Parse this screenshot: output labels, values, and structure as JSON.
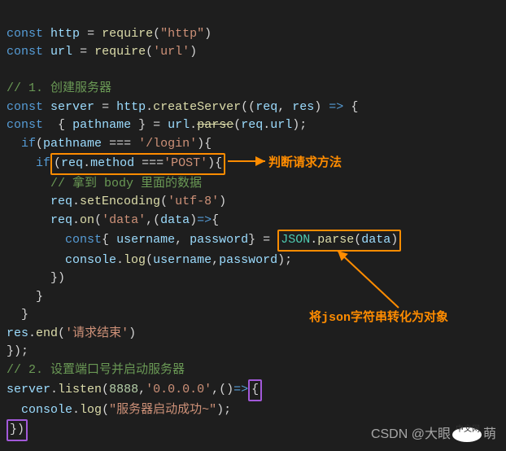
{
  "line1": {
    "kw": "const",
    "var": "http",
    "eq": "=",
    "fn": "require",
    "lp": "(",
    "str": "\"http\"",
    "rp": ")"
  },
  "line2": {
    "kw": "const",
    "var": "url",
    "eq": "=",
    "fn": "require",
    "lp": "(",
    "str": "'url'",
    "rp": ")"
  },
  "comment1": "// 1. 创建服务器",
  "line4": {
    "kw": "const",
    "var": "server",
    "eq": "=",
    "obj": "http",
    "dot": ".",
    "fn": "createServer",
    "lp": "(",
    "p1": "(",
    "a1": "req",
    "c": ",",
    "a2": "res",
    "p2": ")",
    "arrow": "=>",
    "lb": "{"
  },
  "line5": {
    "kw": "const",
    "lb": "{",
    "var": "pathname",
    "rb": "}",
    "eq": "=",
    "obj": "url",
    "dot": ".",
    "fn": "parse",
    "lp": "(",
    "a1": "req",
    "d2": ".",
    "a2": "url",
    "rp": ")",
    "sc": ";"
  },
  "line6": {
    "kw": "if",
    "lp": "(",
    "var": "pathname",
    "op": "===",
    "str": "'/login'",
    "rp": ")",
    "lb": "{"
  },
  "line7": {
    "kw": "if",
    "lp": "(",
    "a1": "req",
    "dot": ".",
    "a2": "method",
    "op": "===",
    "str": "'POST'",
    "rp": ")",
    "lb": "{"
  },
  "comment2": "// 拿到 body 里面的数据",
  "line9": {
    "a1": "req",
    "dot": ".",
    "fn": "setEncoding",
    "lp": "(",
    "str": "'utf-8'",
    "rp": ")"
  },
  "line10": {
    "a1": "req",
    "dot": ".",
    "fn": "on",
    "lp": "(",
    "str": "'data'",
    "c": ",",
    "p1": "(",
    "a2": "data",
    "p2": ")",
    "arrow": "=>",
    "lb": "{"
  },
  "line11": {
    "kw": "const",
    "lb": "{",
    "v1": "username",
    "c": ",",
    "v2": "password",
    "rb": "}",
    "eq": "=",
    "obj": "JSON",
    "dot": ".",
    "fn": "parse",
    "lp": "(",
    "arg": "data",
    "rp": ")"
  },
  "line12": {
    "obj": "console",
    "dot": ".",
    "fn": "log",
    "lp": "(",
    "a1": "username",
    "c": ",",
    "a2": "password",
    "rp": ")",
    "sc": ";"
  },
  "line13": "})",
  "line14": "}",
  "line15": "}",
  "line16": {
    "a1": "res",
    "dot": ".",
    "fn": "end",
    "lp": "(",
    "str": "'请求结束'",
    "rp": ")"
  },
  "line17": "});",
  "comment3": "// 2. 设置端口号并启动服务器",
  "line19": {
    "obj": "server",
    "dot": ".",
    "fn": "listen",
    "lp": "(",
    "n": "8888",
    "c": ",",
    "str": "'0.0.0.0'",
    "c2": ",",
    "p1": "()",
    "arrow": "=>",
    "lb": "{"
  },
  "line20": {
    "obj": "console",
    "dot": ".",
    "fn": "log",
    "lp": "(",
    "str": "\"服务器启动成功~\"",
    "rp": ")",
    "sc": ";"
  },
  "line21": "})",
  "annotation1": "判断请求方法",
  "annotation2": "将json字符串转化为对象",
  "watermark": {
    "prefix": "CSDN @大眼",
    "suffix": "萌"
  },
  "wm_zh": "中文网"
}
